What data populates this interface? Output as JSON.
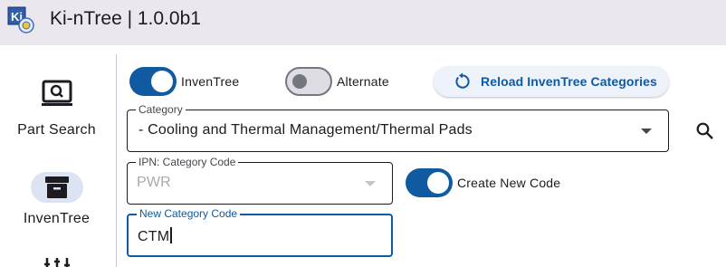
{
  "window": {
    "title": "Ki-nTree | 1.0.0b1"
  },
  "rail": {
    "items": [
      {
        "label": "Part Search",
        "icon": "search-window-icon",
        "active": false
      },
      {
        "label": "InvenTree",
        "icon": "archive-box-icon",
        "active": true
      }
    ]
  },
  "toggles": {
    "inventree": {
      "label": "InvenTree",
      "on": true
    },
    "alternate": {
      "label": "Alternate",
      "on": false
    },
    "create_new_code": {
      "label": "Create New Code",
      "on": true
    }
  },
  "reload_button": {
    "label": "Reload InvenTree Categories",
    "icon": "refresh-icon"
  },
  "category": {
    "label": "Category",
    "value": "- Cooling and Thermal Management/Thermal Pads",
    "icon": "dropdown-arrow-icon"
  },
  "search": {
    "icon": "search-icon"
  },
  "ipn_category_code": {
    "label": "IPN: Category Code",
    "value": "PWR",
    "disabled": true
  },
  "new_category_code": {
    "label": "New Category Code",
    "value": "CTM",
    "focused": true
  },
  "colors": {
    "primary": "#0f5aa0",
    "titlebar": "#eae7ee",
    "active_indicator": "#dce3f3"
  }
}
